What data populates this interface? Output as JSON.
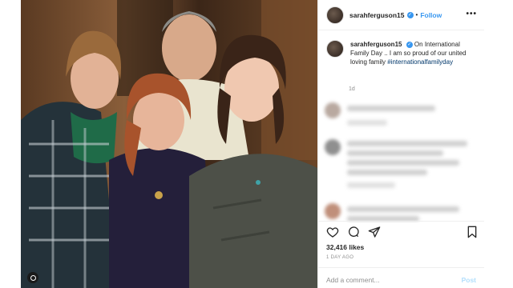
{
  "post": {
    "username": "sarahferguson15",
    "follow_label": "Follow",
    "more_label": "•••",
    "verified_mark": "✓",
    "separator": "•"
  },
  "caption": {
    "username": "sarahferguson15",
    "text": " On International Family Day .. I am so proud of our united loving family ",
    "hashtag": "#internationalfamilyday",
    "time": "1d"
  },
  "stats": {
    "likes": "32,416 likes",
    "posted": "1 DAY AGO"
  },
  "comment_box": {
    "placeholder": "Add a comment...",
    "post_label": "Post"
  },
  "icons": [
    "heart-icon",
    "comment-icon",
    "share-icon",
    "bookmark-icon",
    "instagram-glyph-icon",
    "verified-badge-icon"
  ],
  "colors": {
    "link_blue": "#3897f0",
    "hashtag": "#00376b",
    "text": "#262626",
    "muted": "#8e8e8e",
    "post_disabled": "#b2dffc"
  }
}
